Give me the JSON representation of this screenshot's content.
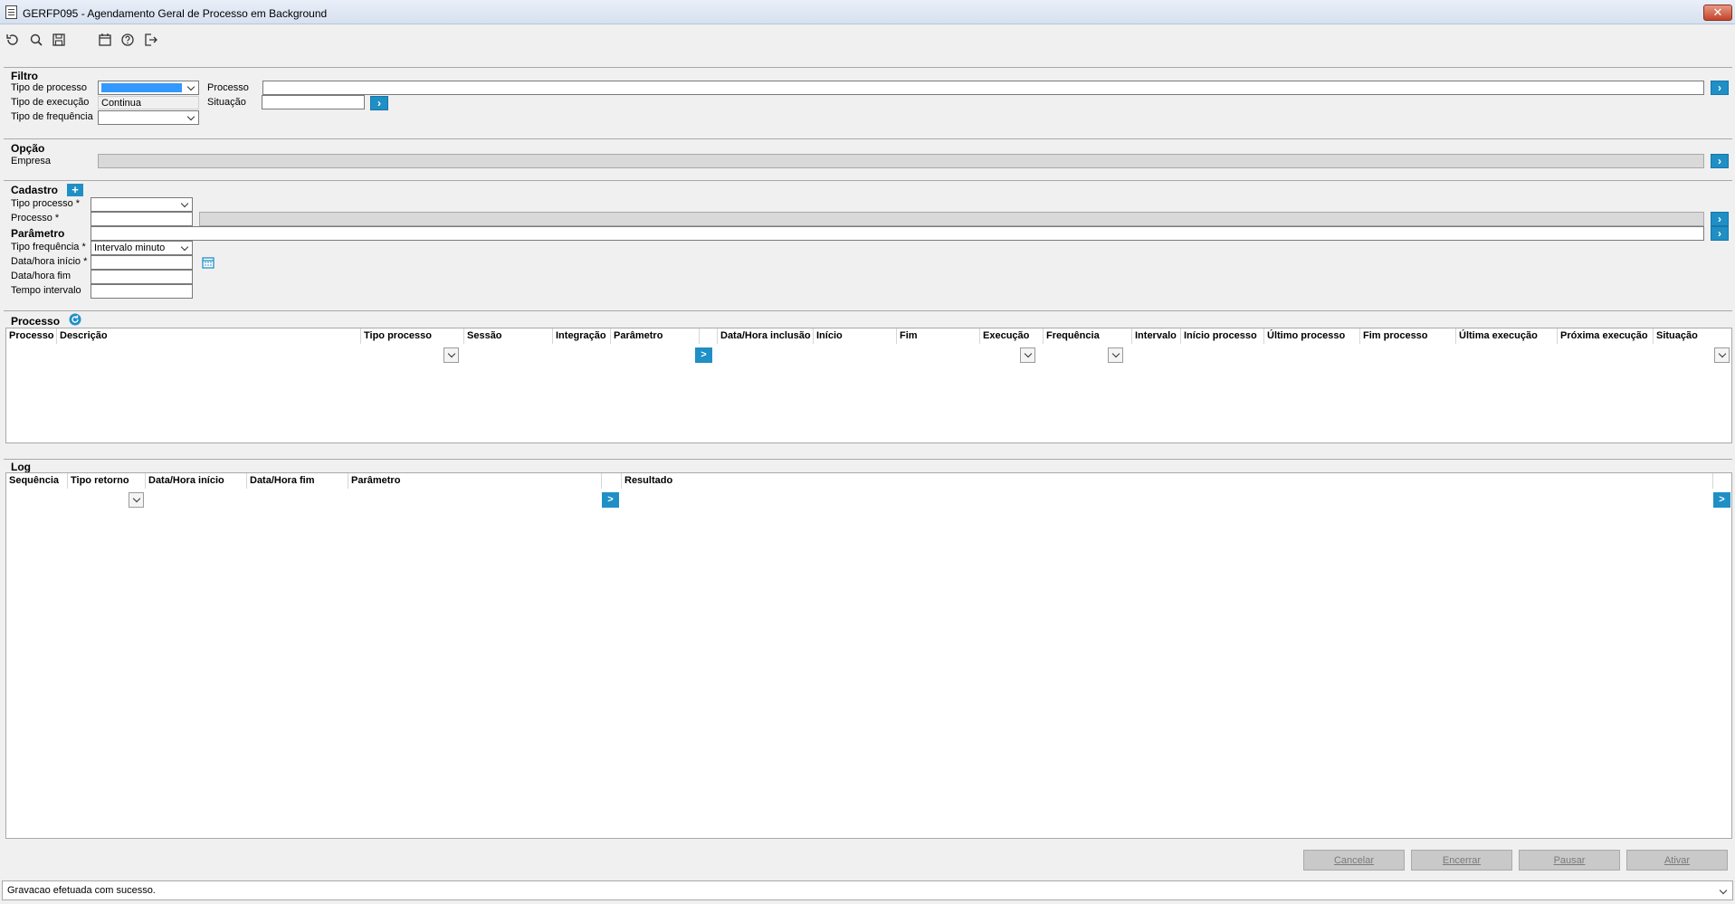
{
  "window": {
    "title": "GERFP095 - Agendamento Geral de Processo em Background",
    "close_label": "✕"
  },
  "toolbar": {
    "icons": [
      "undo-icon",
      "search-icon",
      "save-icon",
      "calendar-icon",
      "help-icon",
      "exit-icon"
    ]
  },
  "filtro": {
    "title": "Filtro",
    "tipo_processo_label": "Tipo de processo",
    "tipo_execucao_label": "Tipo de execução",
    "tipo_frequencia_label": "Tipo de frequência",
    "dropdown_option": "Continua",
    "processo_label": "Processo",
    "situacao_label": "Situação"
  },
  "opcao": {
    "title": "Opção",
    "empresa_label": "Empresa"
  },
  "cadastro": {
    "title": "Cadastro",
    "add_label": "+",
    "tipo_processo_label": "Tipo processo *",
    "processo_label": "Processo *",
    "parametro_label": "Parâmetro",
    "tipo_frequencia_label": "Tipo frequência *",
    "tipo_frequencia_value": "Intervalo minuto",
    "data_inicio_label": "Data/hora início *",
    "data_fim_label": "Data/hora fim",
    "tempo_intervalo_label": "Tempo intervalo"
  },
  "processo_grid": {
    "title": "Processo",
    "columns": [
      "Processo",
      "Descrição",
      "Tipo processo",
      "Sessão",
      "Integração",
      "Parâmetro",
      "",
      "Data/Hora inclusão",
      "Início",
      "Fim",
      "Execução",
      "Frequência",
      "Intervalo",
      "Início processo",
      "Último processo",
      "Fim processo",
      "Última execução",
      "Próxima execução",
      "Situação"
    ]
  },
  "log_grid": {
    "title": "Log",
    "columns": [
      "Sequência",
      "Tipo retorno",
      "Data/Hora início",
      "Data/Hora fim",
      "Parâmetro",
      "",
      "Resultado"
    ]
  },
  "go_label": ">",
  "footer": {
    "cancelar": "Cancelar",
    "encerrar": "Encerrar",
    "pausar": "Pausar",
    "ativar": "Ativar"
  },
  "status_text": "Gravacao efetuada com sucesso."
}
